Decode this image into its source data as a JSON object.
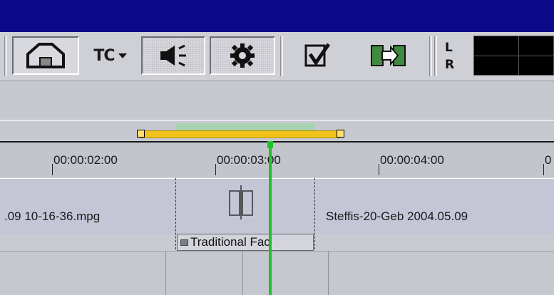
{
  "toolbar": {
    "tc_label": "TC",
    "level_meter_labels": [
      "L",
      "R"
    ]
  },
  "ruler": {
    "ticks": [
      "00:00:02:00",
      "00:00:03:00",
      "00:00:04:00",
      "0"
    ]
  },
  "track": {
    "clip_left_label": ".09  10-16-36.mpg",
    "clip_right_label": "Steffis-20-Geb  2004.05.09"
  },
  "transition": {
    "label": "Traditional Fac"
  },
  "colors": {
    "title_bar": "#0a0a8a",
    "range_bar": "#f1c21a",
    "playhead": "#22c02a"
  }
}
